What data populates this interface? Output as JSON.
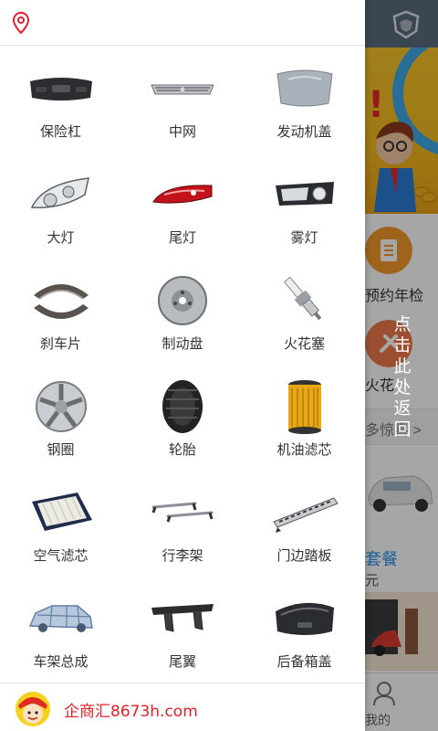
{
  "drawer": {
    "header": {
      "location_icon": "location-pin-icon",
      "accent": "#e5202a"
    },
    "parts": [
      {
        "label": "保险杠",
        "icon": "bumper-icon"
      },
      {
        "label": "中网",
        "icon": "grille-icon"
      },
      {
        "label": "发动机盖",
        "icon": "hood-icon"
      },
      {
        "label": "大灯",
        "icon": "headlight-icon"
      },
      {
        "label": "尾灯",
        "icon": "taillight-icon"
      },
      {
        "label": "雾灯",
        "icon": "foglight-icon"
      },
      {
        "label": "刹车片",
        "icon": "brake-shoe-icon"
      },
      {
        "label": "制动盘",
        "icon": "brake-disc-icon"
      },
      {
        "label": "火花塞",
        "icon": "spark-plug-icon"
      },
      {
        "label": "钢圈",
        "icon": "wheel-rim-icon"
      },
      {
        "label": "轮胎",
        "icon": "tire-icon"
      },
      {
        "label": "机油滤芯",
        "icon": "oil-filter-icon"
      },
      {
        "label": "空气滤芯",
        "icon": "air-filter-icon"
      },
      {
        "label": "行李架",
        "icon": "roof-rack-icon"
      },
      {
        "label": "门边踏板",
        "icon": "side-step-icon"
      },
      {
        "label": "车架总成",
        "icon": "car-frame-icon"
      },
      {
        "label": "尾翼",
        "icon": "spoiler-icon"
      },
      {
        "label": "后备箱盖",
        "icon": "trunk-lid-icon"
      }
    ],
    "footer": {
      "brand": "企商汇8673h.com",
      "avatar_icon": "mascot-avatar-icon"
    }
  },
  "background": {
    "back_hint": "点击此处返回",
    "service_1": "预约年检",
    "service_2": "火花",
    "more": "多惊喜 >",
    "package_title": "套餐",
    "package_sub": "元",
    "tab_me": "我的"
  }
}
